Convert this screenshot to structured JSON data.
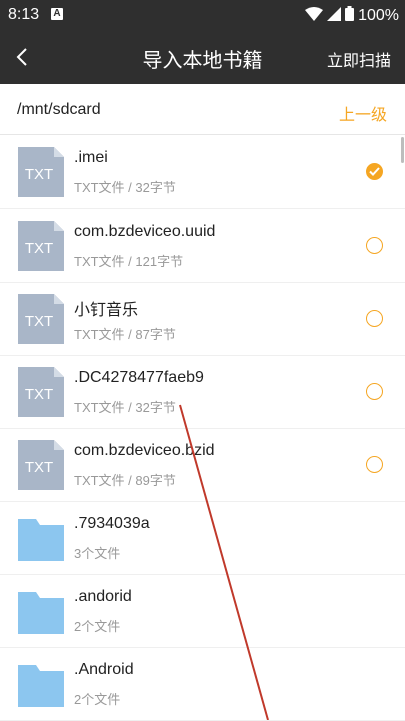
{
  "status_bar": {
    "time": "8:13",
    "notification_letter": "A",
    "battery": "100%"
  },
  "nav": {
    "title": "导入本地书籍",
    "scan_label": "立即扫描"
  },
  "path_bar": {
    "path": "/mnt/sdcard",
    "up_label": "上一级"
  },
  "files": [
    {
      "name": ".imei",
      "meta": "TXT文件 / 32字节",
      "type": "txt",
      "icon_label": "TXT",
      "checked": true
    },
    {
      "name": "com.bzdeviceo.uuid",
      "meta": "TXT文件 / 121字节",
      "type": "txt",
      "icon_label": "TXT",
      "checked": false
    },
    {
      "name": "小钉音乐",
      "meta": "TXT文件 / 87字节",
      "type": "txt",
      "icon_label": "TXT",
      "checked": false
    },
    {
      "name": ".DC4278477faeb9",
      "meta": "TXT文件 / 32字节",
      "type": "txt",
      "icon_label": "TXT",
      "checked": false
    },
    {
      "name": "com.bzdeviceo.bzid",
      "meta": "TXT文件 / 89字节",
      "type": "txt",
      "icon_label": "TXT",
      "checked": false
    },
    {
      "name": ".7934039a",
      "meta": "3个文件",
      "type": "folder"
    },
    {
      "name": ".andorid",
      "meta": "2个文件",
      "type": "folder"
    },
    {
      "name": ".Android",
      "meta": "2个文件",
      "type": "folder"
    }
  ],
  "colors": {
    "accent": "#f5a623",
    "header": "#2f2f2f",
    "txt_icon": "#a9b6c8",
    "folder_icon": "#8cc6ef",
    "annotation_line": "#c0392b"
  },
  "icons": {
    "back": "chevron-left-icon",
    "wifi": "wifi-icon",
    "signal": "signal-icon",
    "battery": "battery-icon"
  }
}
